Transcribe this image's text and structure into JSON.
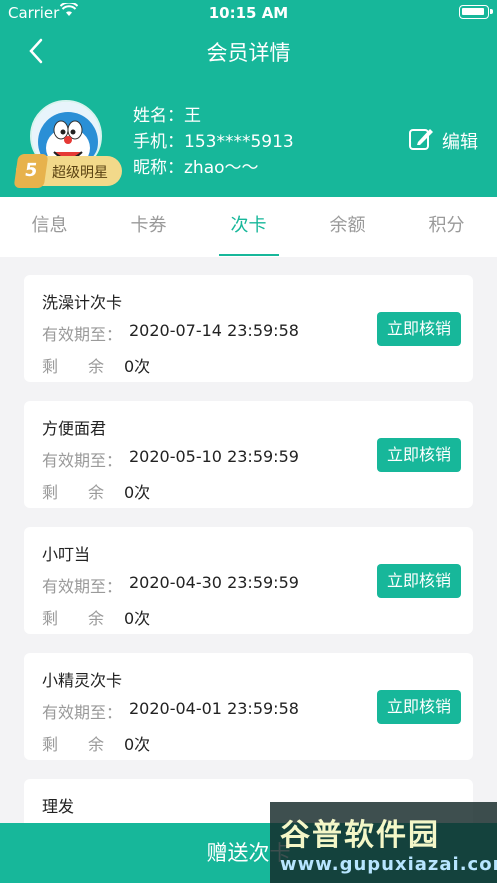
{
  "status_bar": {
    "carrier": "Carrier",
    "time": "10:15 AM"
  },
  "nav": {
    "title": "会员详情"
  },
  "member": {
    "name_line": "姓名：王",
    "phone_line": "手机：153****5913",
    "nickname_line": "昵称：zhao～～",
    "badge_number": "5",
    "badge_label": "超级明星"
  },
  "edit_label": "编辑",
  "tabs": [
    {
      "label": "信息"
    },
    {
      "label": "卡券"
    },
    {
      "label": "次卡",
      "active": true
    },
    {
      "label": "余额"
    },
    {
      "label": "积分"
    }
  ],
  "card_labels": {
    "expiry": "有效期至：",
    "remaining": "剩余",
    "verify_button": "立即核销"
  },
  "cards": [
    {
      "name": "洗澡计次卡",
      "expiry": "2020-07-14 23:59:58",
      "remaining": "0次"
    },
    {
      "name": "方便面君",
      "expiry": "2020-05-10 23:59:59",
      "remaining": "0次"
    },
    {
      "name": "小叮当",
      "expiry": "2020-04-30 23:59:59",
      "remaining": "0次"
    },
    {
      "name": "小精灵次卡",
      "expiry": "2020-04-01 23:59:58",
      "remaining": "0次"
    },
    {
      "name": "理发"
    }
  ],
  "bottom_button": "赠送次卡",
  "watermark": {
    "line1": "谷普软件园",
    "line2": "www.gupuxiazai.com"
  },
  "colors": {
    "brand": "#17b79a",
    "background": "#f3f3f5",
    "badge_gold": "#e7b24c"
  }
}
